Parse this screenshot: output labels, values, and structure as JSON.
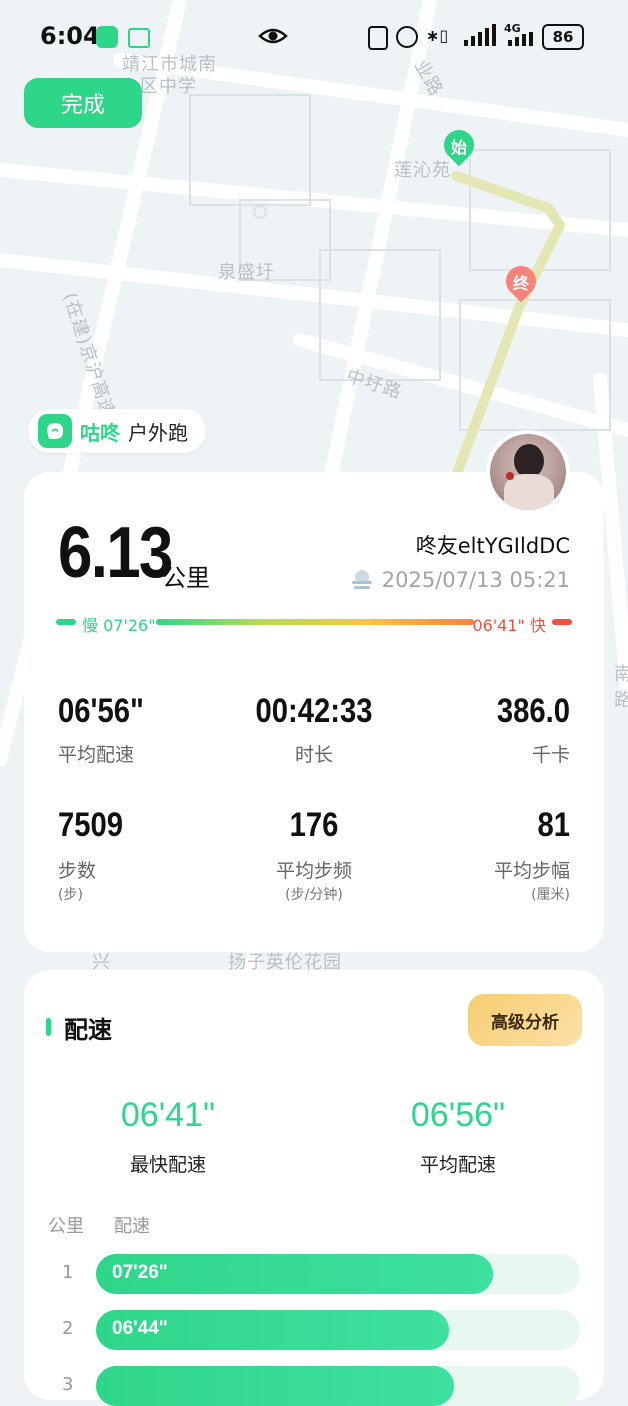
{
  "status": {
    "time": "6:04",
    "battery": "86",
    "network": "4G"
  },
  "map": {
    "labels": [
      "靖江市城南",
      "区中学",
      "泉盛圩",
      "中圩路",
      "莲沁苑",
      "(在建)京沪高速",
      "业路",
      "南路",
      "扬子英伦花园",
      "兴"
    ],
    "start_marker": "始",
    "end_marker": "终"
  },
  "header": {
    "done_label": "完成"
  },
  "brand": {
    "name": "咕咚",
    "activity_type": "户外跑"
  },
  "summary": {
    "distance": "6.13",
    "distance_unit": "公里",
    "username": "咚友eltYGIldDC",
    "datetime": "2025/07/13 05:21",
    "slow_label": "慢 07'26\"",
    "fast_label": "06'41\" 快"
  },
  "stats": [
    {
      "value": "06'56\"",
      "label": "平均配速",
      "unit": ""
    },
    {
      "value": "00:42:33",
      "label": "时长",
      "unit": ""
    },
    {
      "value": "386.0",
      "label": "千卡",
      "unit": ""
    },
    {
      "value": "7509",
      "label": "步数",
      "unit": "(步)"
    },
    {
      "value": "176",
      "label": "平均步频",
      "unit": "(步/分钟)"
    },
    {
      "value": "81",
      "label": "平均步幅",
      "unit": "(厘米)"
    }
  ],
  "pace_section": {
    "title": "配速",
    "advanced_label": "高级分析",
    "fastest_value": "06'41\"",
    "fastest_label": "最快配速",
    "average_value": "06'56\"",
    "average_label": "平均配速",
    "col_km": "公里",
    "col_pace": "配速",
    "splits": [
      {
        "km": "1",
        "pace": "07'26\"",
        "fraction": 0.82
      },
      {
        "km": "2",
        "pace": "06'44\"",
        "fraction": 0.73
      },
      {
        "km": "3",
        "pace": "",
        "fraction": 0.74
      }
    ]
  },
  "colors": {
    "accent": "#2ed68a",
    "fast": "#f0503d",
    "gold": "#f7cd72"
  }
}
